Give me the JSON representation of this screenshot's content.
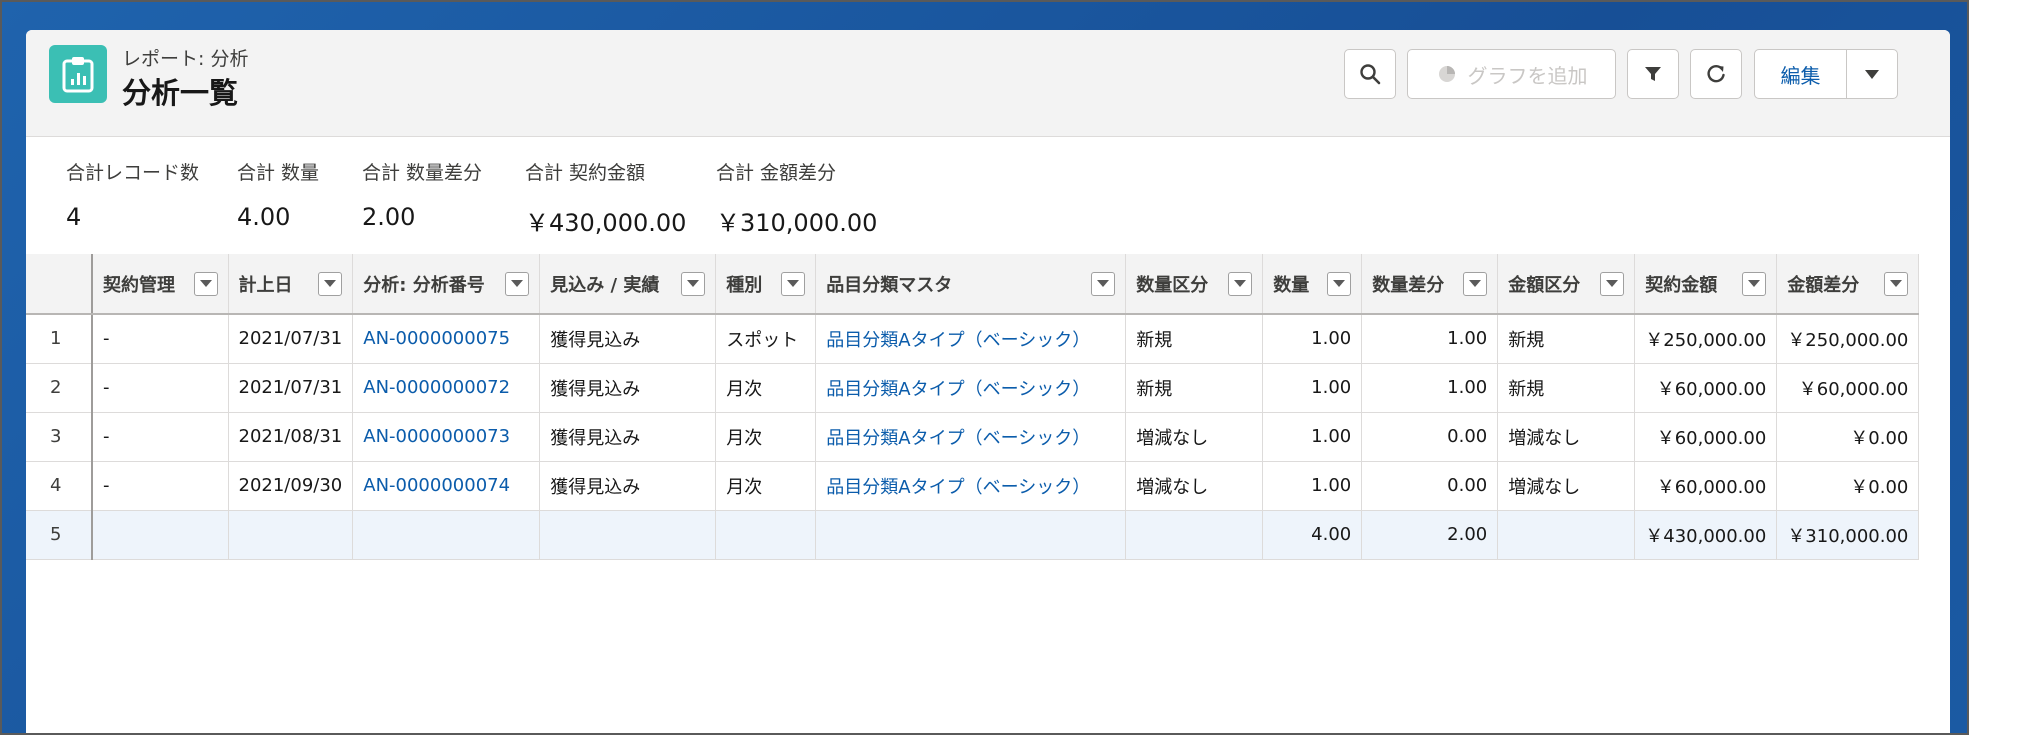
{
  "header": {
    "eyebrow": "レポート: 分析",
    "title": "分析一覧",
    "add_chart_label": "グラフを追加",
    "edit_label": "編集"
  },
  "icons": {
    "report": "report-icon",
    "search": "search-icon",
    "chart": "chart-icon",
    "filter": "filter-icon",
    "refresh": "refresh-icon",
    "dropdown": "chevron-down-icon"
  },
  "colors": {
    "accent": "#3bbfb4",
    "link": "#0b5cab",
    "brand_bg": "#1b5aa3"
  },
  "summary": [
    {
      "label": "合計レコード数",
      "value": "4"
    },
    {
      "label": "合計 数量",
      "value": "4.00"
    },
    {
      "label": "合計 数量差分",
      "value": "2.00"
    },
    {
      "label": "合計 契約金額",
      "value": "￥430,000.00"
    },
    {
      "label": "合計 金額差分",
      "value": "￥310,000.00"
    }
  ],
  "table": {
    "columns": [
      "契約管理",
      "計上日",
      "分析: 分析番号",
      "見込み / 実績",
      "種別",
      "品目分類マスタ",
      "数量区分",
      "数量",
      "数量差分",
      "金額区分",
      "契約金額",
      "金額差分"
    ],
    "rows": [
      {
        "n": "1",
        "cells": [
          "-",
          "2021/07/31",
          "AN-0000000075",
          "獲得見込み",
          "スポット",
          "品目分類Aタイプ（ベーシック）",
          "新規",
          "1.00",
          "1.00",
          "新規",
          "￥250,000.00",
          "￥250,000.00"
        ]
      },
      {
        "n": "2",
        "cells": [
          "-",
          "2021/07/31",
          "AN-0000000072",
          "獲得見込み",
          "月次",
          "品目分類Aタイプ（ベーシック）",
          "新規",
          "1.00",
          "1.00",
          "新規",
          "￥60,000.00",
          "￥60,000.00"
        ]
      },
      {
        "n": "3",
        "cells": [
          "-",
          "2021/08/31",
          "AN-0000000073",
          "獲得見込み",
          "月次",
          "品目分類Aタイプ（ベーシック）",
          "増減なし",
          "1.00",
          "0.00",
          "増減なし",
          "￥60,000.00",
          "￥0.00"
        ]
      },
      {
        "n": "4",
        "cells": [
          "-",
          "2021/09/30",
          "AN-0000000074",
          "獲得見込み",
          "月次",
          "品目分類Aタイプ（ベーシック）",
          "増減なし",
          "1.00",
          "0.00",
          "増減なし",
          "￥60,000.00",
          "￥0.00"
        ]
      },
      {
        "n": "5",
        "cells": [
          "",
          "",
          "",
          "",
          "",
          "",
          "",
          "4.00",
          "2.00",
          "",
          "￥430,000.00",
          "￥310,000.00"
        ]
      }
    ]
  }
}
